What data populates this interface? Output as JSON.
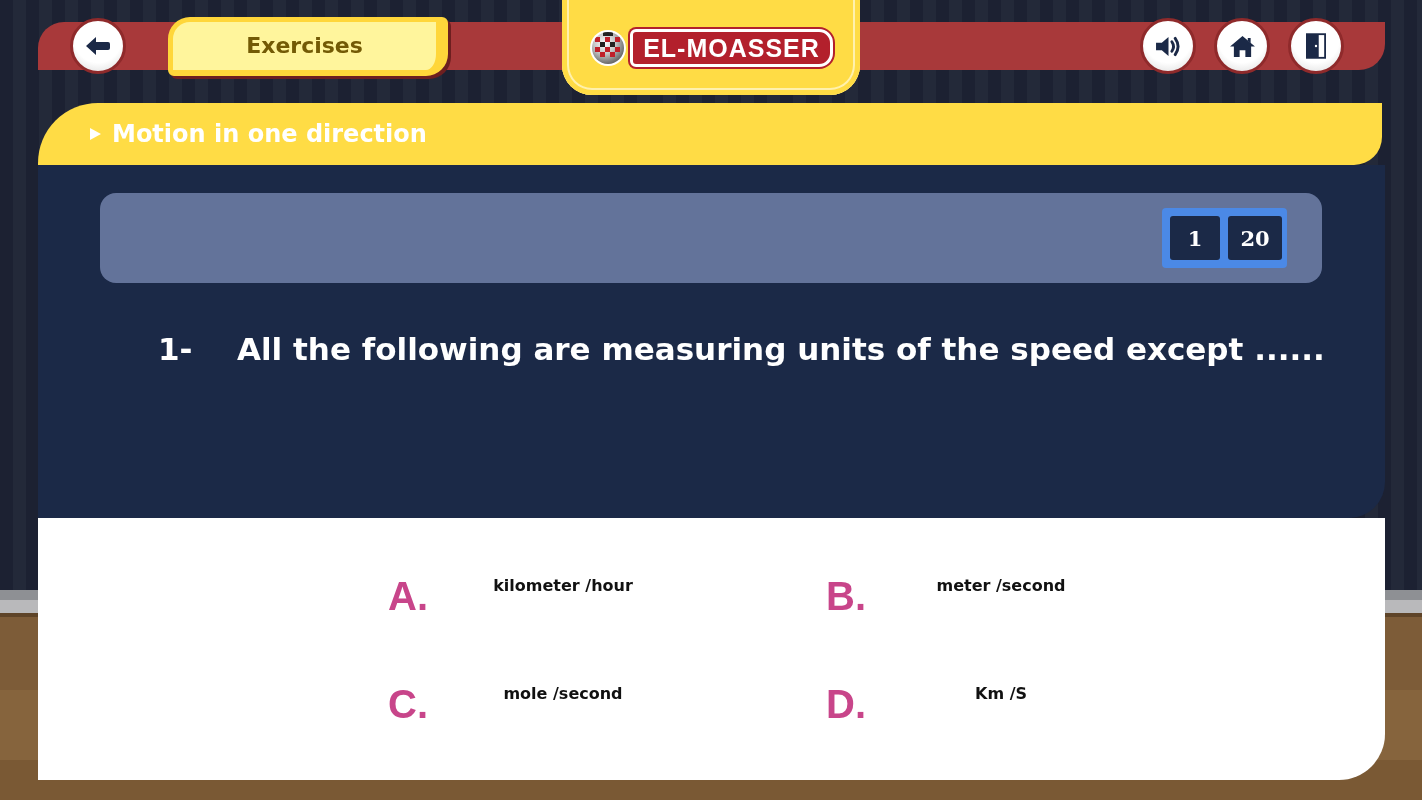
{
  "top_bar": {
    "section_tab": {
      "label": "Exercises"
    },
    "logo": {
      "text": "EL-MOASSER"
    },
    "buttons": [
      {
        "kind": "sound"
      },
      {
        "kind": "home"
      },
      {
        "kind": "exit"
      }
    ]
  },
  "lesson": {
    "title": "Motion in one direction"
  },
  "counter": {
    "current": "1",
    "total": "20"
  },
  "question": {
    "number": "1-",
    "text": "All the following are measuring units of the speed except ......"
  },
  "options": [
    {
      "letter": "A.",
      "text": "kilometer /hour",
      "selected": false
    },
    {
      "letter": "B.",
      "text": "meter /second",
      "selected": false
    },
    {
      "letter": "C.",
      "text": "mole /second",
      "selected": false
    },
    {
      "letter": "D.",
      "text": "Km /S",
      "selected": false
    }
  ]
}
